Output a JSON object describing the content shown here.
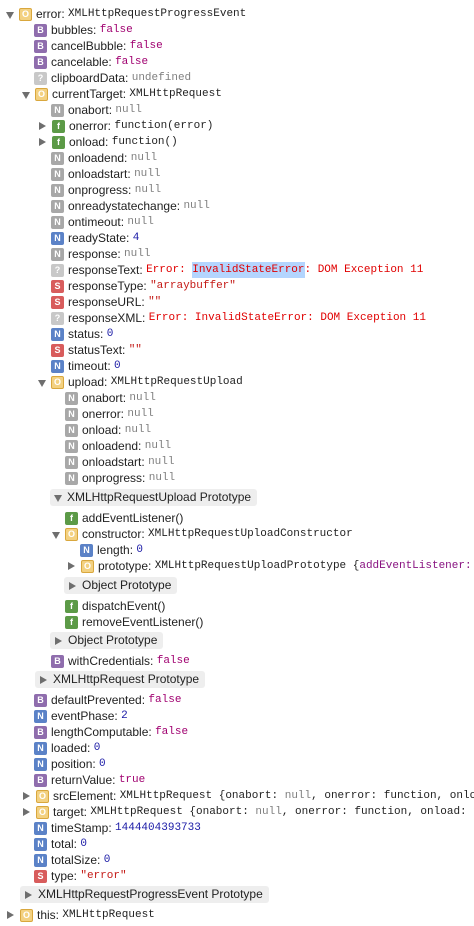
{
  "tree": {
    "root": {
      "key": "error:",
      "value": "XMLHttpRequestProgressEvent"
    },
    "bubbles": {
      "key": "bubbles:",
      "value": "false"
    },
    "cancelBubble": {
      "key": "cancelBubble:",
      "value": "false"
    },
    "cancelable": {
      "key": "cancelable:",
      "value": "false"
    },
    "clipboardData": {
      "key": "clipboardData:",
      "value": "undefined"
    },
    "currentTarget": {
      "key": "currentTarget:",
      "value": "XMLHttpRequest"
    },
    "xhr": {
      "onabort": {
        "key": "onabort:",
        "value": "null"
      },
      "onerror": {
        "key": "onerror:",
        "value": "function(error)"
      },
      "onload": {
        "key": "onload:",
        "value": "function()"
      },
      "onloadend": {
        "key": "onloadend:",
        "value": "null"
      },
      "onloadstart": {
        "key": "onloadstart:",
        "value": "null"
      },
      "onprogress": {
        "key": "onprogress:",
        "value": "null"
      },
      "onreadystatechange": {
        "key": "onreadystatechange:",
        "value": "null"
      },
      "ontimeout": {
        "key": "ontimeout:",
        "value": "null"
      },
      "readyState": {
        "key": "readyState:",
        "value": "4"
      },
      "response": {
        "key": "response:",
        "value": "null"
      },
      "responseText": {
        "key": "responseText:",
        "value_pre": "Error: ",
        "value_hl": "InvalidStateError",
        "value_post": ": DOM Exception 11"
      },
      "responseType": {
        "key": "responseType:",
        "value": "\"arraybuffer\""
      },
      "responseURL": {
        "key": "responseURL:",
        "value": "\"\""
      },
      "responseXML": {
        "key": "responseXML:",
        "value": "Error: InvalidStateError: DOM Exception 11"
      },
      "status": {
        "key": "status:",
        "value": "0"
      },
      "statusText": {
        "key": "statusText:",
        "value": "\"\""
      },
      "timeout": {
        "key": "timeout:",
        "value": "0"
      },
      "upload": {
        "key": "upload:",
        "value": "XMLHttpRequestUpload"
      },
      "uploadChildren": {
        "onabort": {
          "key": "onabort:",
          "value": "null"
        },
        "onerror": {
          "key": "onerror:",
          "value": "null"
        },
        "onload": {
          "key": "onload:",
          "value": "null"
        },
        "onloadend": {
          "key": "onloadend:",
          "value": "null"
        },
        "onloadstart": {
          "key": "onloadstart:",
          "value": "null"
        },
        "onprogress": {
          "key": "onprogress:",
          "value": "null"
        },
        "proto": "XMLHttpRequestUpload Prototype",
        "addEventListener": "addEventListener()",
        "constructor": {
          "key": "constructor:",
          "value": "XMLHttpRequestUploadConstructor"
        },
        "length": {
          "key": "length:",
          "value": "0"
        },
        "prototype": {
          "key": "prototype:",
          "value_pre": "XMLHttpRequestUploadPrototype {",
          "value_key": "addEventListener:",
          "value_post": " fu"
        },
        "objectProto1": "Object Prototype",
        "dispatchEvent": "dispatchEvent()",
        "removeEventListener": "removeEventListener()",
        "objectProto2": "Object Prototype"
      },
      "withCredentials": {
        "key": "withCredentials:",
        "value": "false"
      },
      "xhrProto": "XMLHttpRequest Prototype"
    },
    "defaultPrevented": {
      "key": "defaultPrevented:",
      "value": "false"
    },
    "eventPhase": {
      "key": "eventPhase:",
      "value": "2"
    },
    "lengthComputable": {
      "key": "lengthComputable:",
      "value": "false"
    },
    "loaded": {
      "key": "loaded:",
      "value": "0"
    },
    "position": {
      "key": "position:",
      "value": "0"
    },
    "returnValue": {
      "key": "returnValue:",
      "value": "true"
    },
    "srcElement": {
      "key": "srcElement:",
      "value_pre": "XMLHttpRequest {onabort: ",
      "value_null": "null",
      "value_post": ", onerror: function, onload:"
    },
    "target": {
      "key": "target:",
      "value_pre": "XMLHttpRequest {onabort: ",
      "value_null": "null",
      "value_post": ", onerror: function, onload: fu"
    },
    "timeStamp": {
      "key": "timeStamp:",
      "value": "1444404393733"
    },
    "total": {
      "key": "total:",
      "value": "0"
    },
    "totalSize": {
      "key": "totalSize:",
      "value": "0"
    },
    "type": {
      "key": "type:",
      "value": "\"error\""
    },
    "eventProto": "XMLHttpRequestProgressEvent Prototype",
    "this": {
      "key": "this:",
      "value": "XMLHttpRequest"
    }
  },
  "badges": {
    "object": "O",
    "boolean": "B",
    "null": "N",
    "number": "N",
    "string": "S",
    "function": "f",
    "undefined": "?"
  }
}
